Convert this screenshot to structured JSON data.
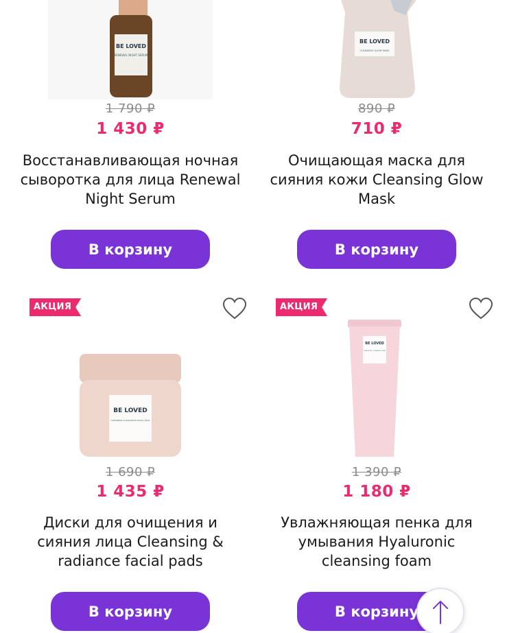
{
  "products": [
    {
      "old_price": "1 790 ₽",
      "new_price": "1 430 ₽",
      "title": "Восстанавливающая ночная сыворотка для лица Renewal Night Serum",
      "cart_label": "В корзину",
      "image_icon": "serum-bottle-image",
      "image_brand": "BE LOVED",
      "image_caption": "RENEWAL NIGHT SERUM"
    },
    {
      "old_price": "890 ₽",
      "new_price": "710 ₽",
      "title": "Очищающая маска для сияния кожи Cleansing Glow Mask",
      "cart_label": "В корзину",
      "image_icon": "mask-pouch-image",
      "image_brand": "BE LOVED",
      "image_caption": "CLEANSING GLOW MASK"
    },
    {
      "badge": "АКЦИЯ",
      "old_price": "1 690 ₽",
      "new_price": "1 435 ₽",
      "title": "Диски для очищения и сияния лица Cleansing & radiance facial pads",
      "cart_label": "В корзину",
      "image_icon": "pads-jar-image",
      "image_brand": "BE LOVED",
      "image_caption": "CLEANSING & RADIANCE FACIAL PADS"
    },
    {
      "badge": "АКЦИЯ",
      "old_price": "1 390 ₽",
      "new_price": "1 180 ₽",
      "title": "Увлажняющая пенка для умывания Hyaluronic cleansing foam",
      "cart_label": "В корзину",
      "image_icon": "foam-tube-image",
      "image_brand": "BE LOVED",
      "image_caption": "HYALURONIC CLEANSING FOAM"
    }
  ],
  "icons": {
    "favorite": "heart-icon",
    "scroll_top": "arrow-up-icon"
  },
  "colors": {
    "accent_button": "#7a33d6",
    "price": "#ea2b6d",
    "badge": "#ec2a6f",
    "old_price": "#8a8a8a"
  }
}
